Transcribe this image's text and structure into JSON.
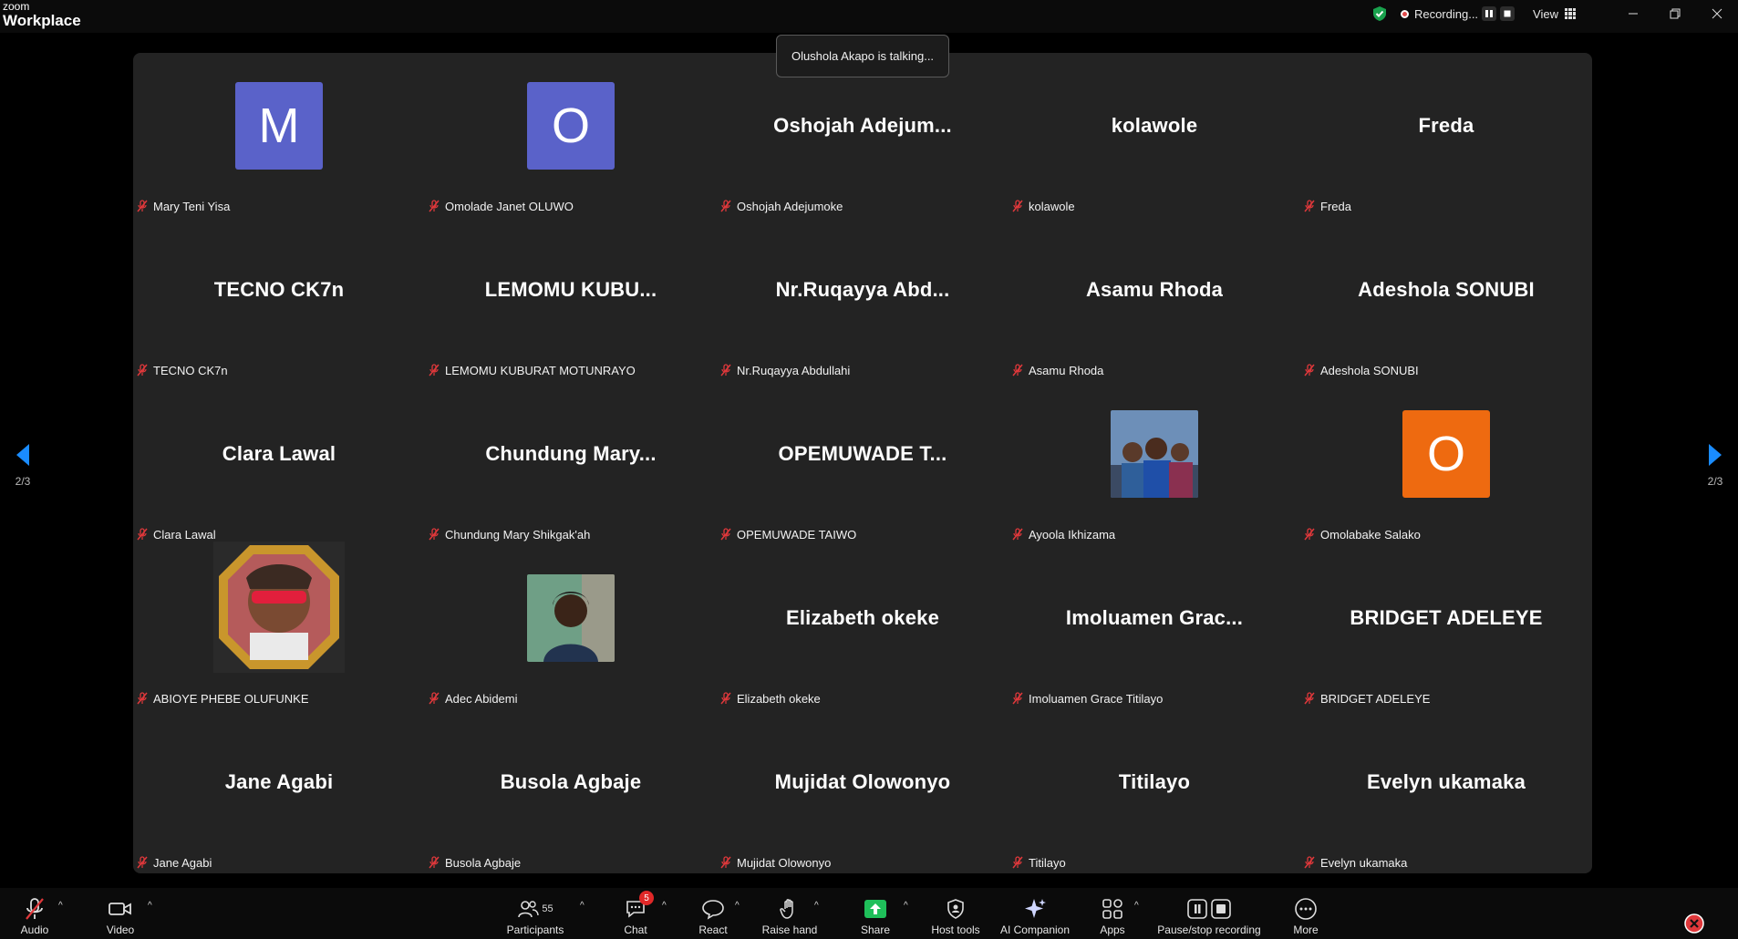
{
  "app": {
    "brand_small": "zoom",
    "brand_big": "Workplace"
  },
  "titlebar": {
    "recording_label": "Recording...",
    "view_label": "View",
    "colors": {
      "shield": "#19a14d",
      "record_dot": "#e14b4b"
    }
  },
  "toast": {
    "text": "Olushola Akapo is talking..."
  },
  "pager": {
    "left": "2/3",
    "right": "2/3",
    "arrow_color": "#1a8cff"
  },
  "tiles": [
    {
      "display": "M",
      "label": "Mary Teni Yisa",
      "kind": "letter",
      "color": "#5a62c9"
    },
    {
      "display": "O",
      "label": "Omolade Janet OLUWO",
      "kind": "letter",
      "color": "#5a62c9"
    },
    {
      "display": "Oshojah  Adejum...",
      "label": "Oshojah Adejumoke",
      "kind": "name"
    },
    {
      "display": "kolawole",
      "label": "kolawole",
      "kind": "name"
    },
    {
      "display": "Freda",
      "label": "Freda",
      "kind": "name"
    },
    {
      "display": "TECNO CK7n",
      "label": "TECNO CK7n",
      "kind": "name"
    },
    {
      "display": "LEMOMU  KUBU...",
      "label": "LEMOMU KUBURAT MOTUNRAYO",
      "kind": "name"
    },
    {
      "display": "Nr.Ruqayya  Abd...",
      "label": "Nr.Ruqayya Abdullahi",
      "kind": "name"
    },
    {
      "display": "Asamu Rhoda",
      "label": "Asamu Rhoda",
      "kind": "name"
    },
    {
      "display": "Adeshola SONUBI",
      "label": "Adeshola SONUBI",
      "kind": "name"
    },
    {
      "display": "Clara Lawal",
      "label": "Clara Lawal",
      "kind": "name"
    },
    {
      "display": "Chundung  Mary...",
      "label": "Chundung Mary Shikgak'ah",
      "kind": "name"
    },
    {
      "display": "OPEMUWADE  T...",
      "label": "OPEMUWADE TAIWO",
      "kind": "name"
    },
    {
      "display": "",
      "label": "Ayoola Ikhizama",
      "kind": "photo-group"
    },
    {
      "display": "O",
      "label": "Omolabake Salako",
      "kind": "letter",
      "color": "#ee6a10"
    },
    {
      "display": "",
      "label": "ABIOYE PHEBE OLUFUNKE",
      "kind": "photo-frame"
    },
    {
      "display": "",
      "label": "Adec Abidemi",
      "kind": "photo-portrait"
    },
    {
      "display": "Elizabeth okeke",
      "label": "Elizabeth okeke",
      "kind": "name"
    },
    {
      "display": "Imoluamen  Grac...",
      "label": "Imoluamen Grace Titilayo",
      "kind": "name"
    },
    {
      "display": "BRIDGET ADELEYE",
      "label": "BRIDGET ADELEYE",
      "kind": "name"
    },
    {
      "display": "Jane Agabi",
      "label": "Jane Agabi",
      "kind": "name"
    },
    {
      "display": "Busola Agbaje",
      "label": "Busola Agbaje",
      "kind": "name"
    },
    {
      "display": "Mujidat Olowonyo",
      "label": "Mujidat Olowonyo",
      "kind": "name"
    },
    {
      "display": "Titilayo",
      "label": "Titilayo",
      "kind": "name"
    },
    {
      "display": "Evelyn ukamaka",
      "label": "Evelyn ukamaka",
      "kind": "name"
    }
  ],
  "toolbar": {
    "audio": "Audio",
    "video": "Video",
    "participants": "Participants",
    "participants_count": "55",
    "chat": "Chat",
    "chat_badge": "5",
    "react": "React",
    "raise_hand": "Raise hand",
    "share": "Share",
    "host_tools": "Host tools",
    "ai_companion": "AI Companion",
    "apps": "Apps",
    "pause_stop": "Pause/stop recording",
    "more": "More",
    "colors": {
      "share": "#1fbf5a",
      "muted": "#e0383b"
    }
  }
}
